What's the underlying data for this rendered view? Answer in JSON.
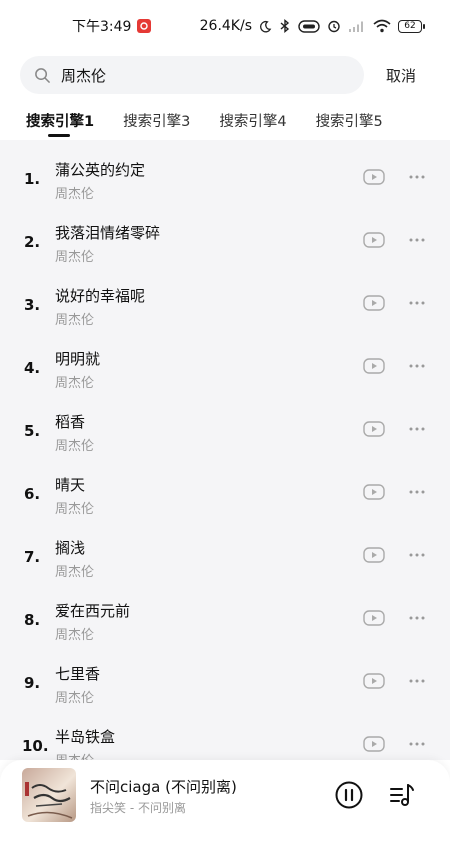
{
  "status": {
    "time": "下午3:49",
    "speed": "26.4K/s",
    "battery": "62"
  },
  "search": {
    "query": "周杰伦",
    "cancel_label": "取消"
  },
  "tabs": [
    {
      "label": "搜索引擎1",
      "active": true
    },
    {
      "label": "搜索引擎3",
      "active": false
    },
    {
      "label": "搜索引擎4",
      "active": false
    },
    {
      "label": "搜索引擎5",
      "active": false
    }
  ],
  "songs": [
    {
      "index": "1.",
      "title": "蒲公英的约定",
      "artist": "周杰伦"
    },
    {
      "index": "2.",
      "title": "我落泪情绪零碎",
      "artist": "周杰伦"
    },
    {
      "index": "3.",
      "title": "说好的幸福呢",
      "artist": "周杰伦"
    },
    {
      "index": "4.",
      "title": "明明就",
      "artist": "周杰伦"
    },
    {
      "index": "5.",
      "title": "稻香",
      "artist": "周杰伦"
    },
    {
      "index": "6.",
      "title": "晴天",
      "artist": "周杰伦"
    },
    {
      "index": "7.",
      "title": "搁浅",
      "artist": "周杰伦"
    },
    {
      "index": "8.",
      "title": "爱在西元前",
      "artist": "周杰伦"
    },
    {
      "index": "9.",
      "title": "七里香",
      "artist": "周杰伦"
    },
    {
      "index": "10.",
      "title": "半岛铁盒",
      "artist": "周杰伦"
    }
  ],
  "player": {
    "title": "不问ciaga (不问别离)",
    "subtitle": "指尖笑 - 不问别离",
    "cover_text": "不问别离"
  }
}
